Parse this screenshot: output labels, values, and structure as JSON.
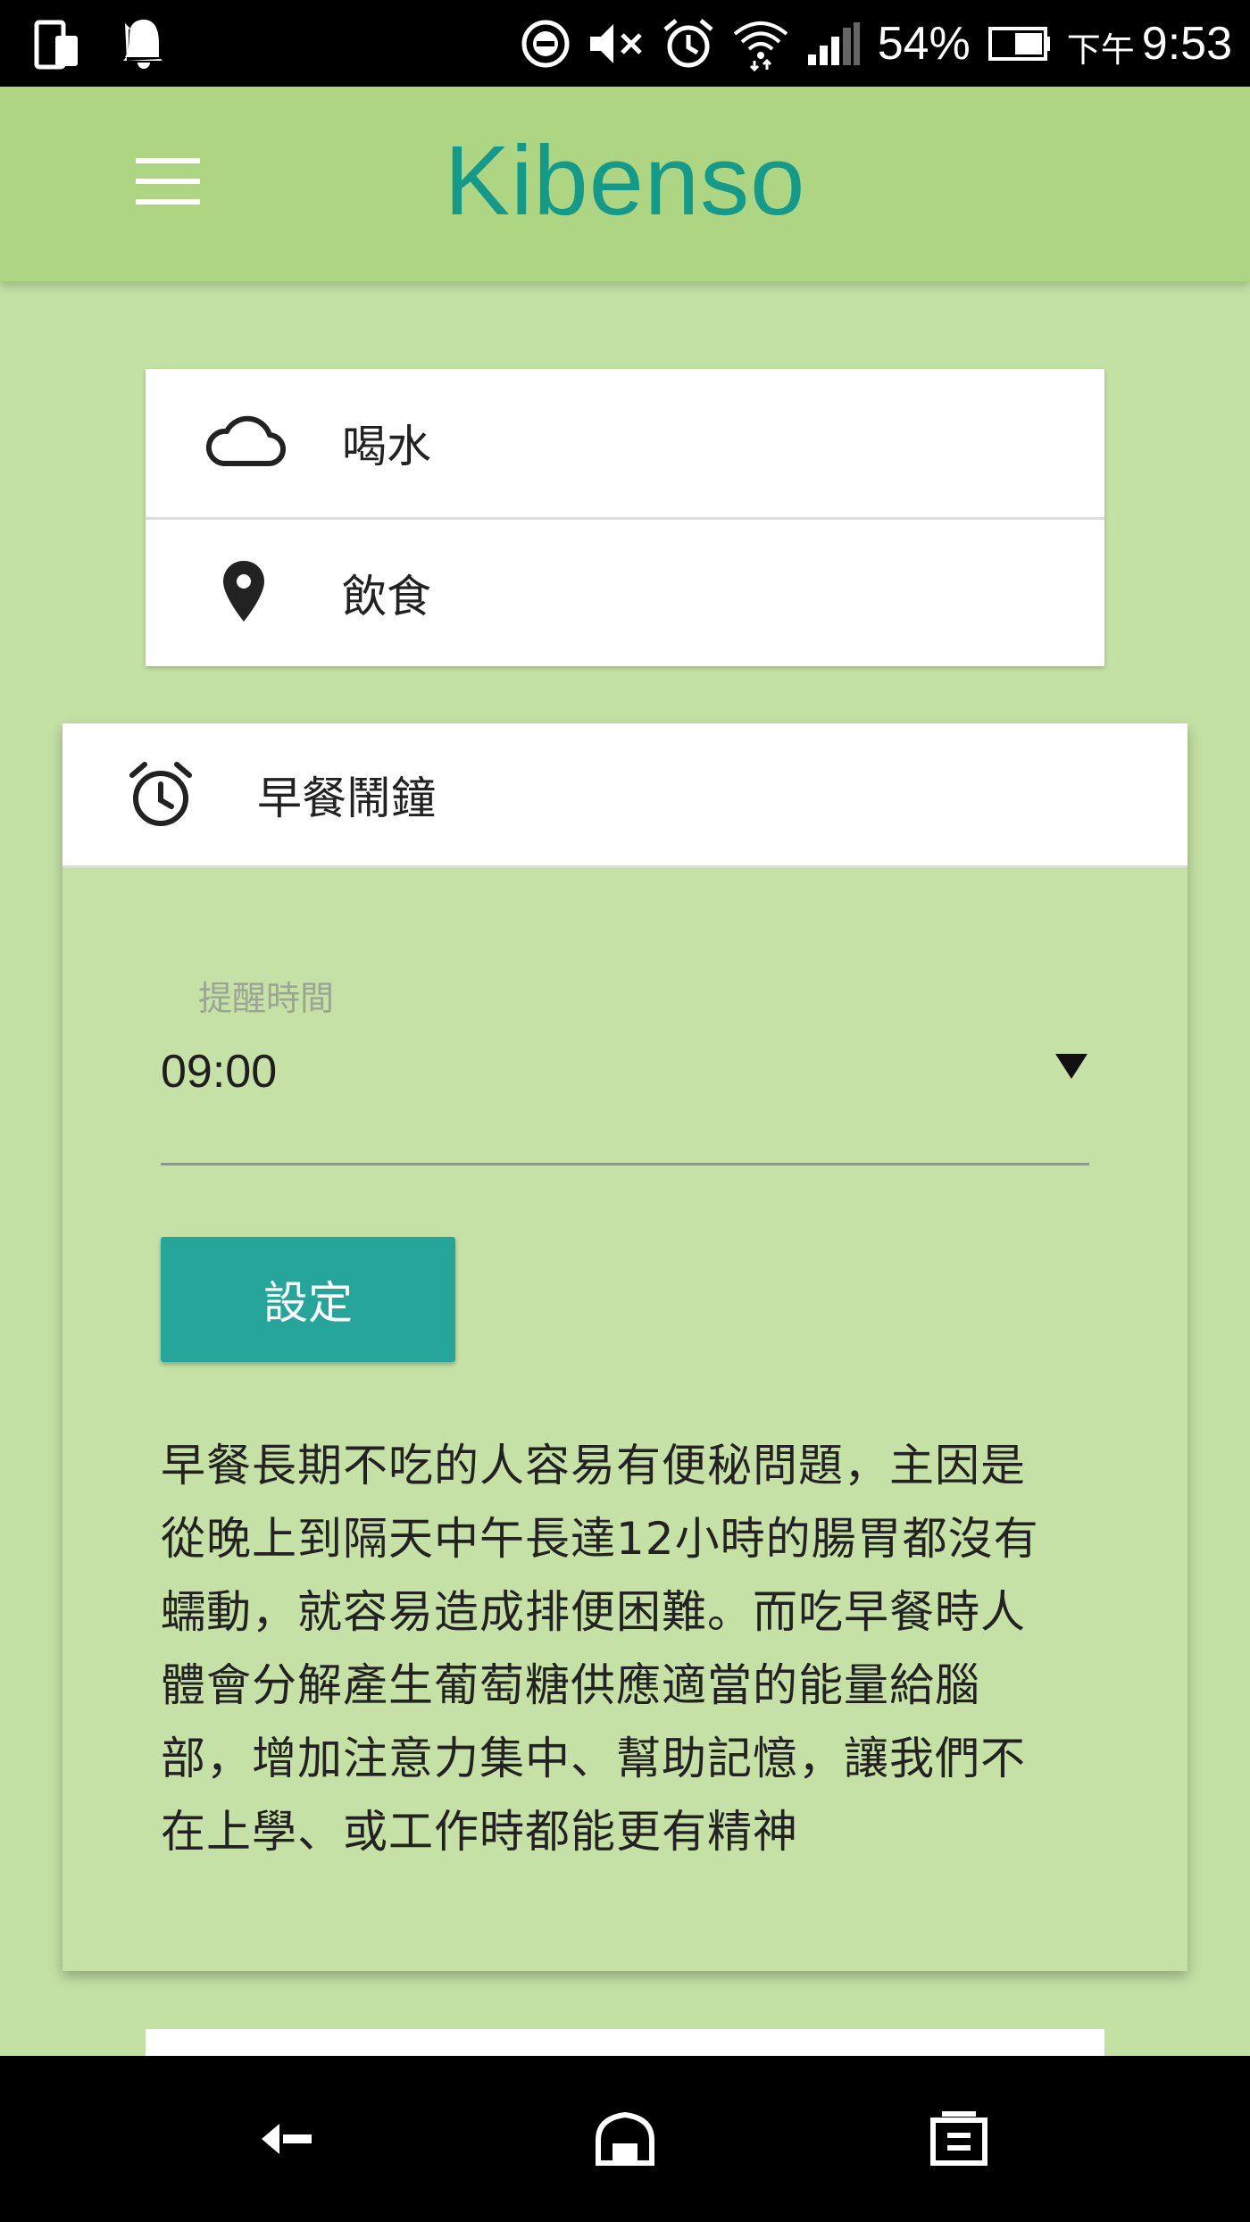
{
  "status_bar": {
    "battery_percent": "54%",
    "time_prefix": "下午",
    "time": "9:53"
  },
  "app_bar": {
    "title": "Kibenso",
    "menu_icon": "hamburger-menu-icon"
  },
  "nav_items": [
    {
      "label": "喝水",
      "icon": "cloud-icon"
    },
    {
      "label": "飲食",
      "icon": "location-pin-icon"
    }
  ],
  "alarm_card": {
    "title": "早餐鬧鐘",
    "icon": "alarm-clock-icon",
    "field_label": "提醒時間",
    "time_value": "09:00",
    "button_label": "設定",
    "description_lines": [
      "早餐長期不吃的人容易有便秘問題，主因是",
      "從晚上到隔天中午長達12小時的腸胃都沒有",
      "蠕動，就容易造成排便困難。而吃早餐時人",
      "體會分解產生葡萄糖供應適當的能量給腦",
      "部，增加注意力集中、幫助記憶，讓我們不",
      "在上學、或工作時都能更有精神"
    ]
  },
  "colors": {
    "app_bar": "#aed581",
    "background": "#c4e1a4",
    "title": "#139a8a",
    "button": "#26a69a"
  }
}
